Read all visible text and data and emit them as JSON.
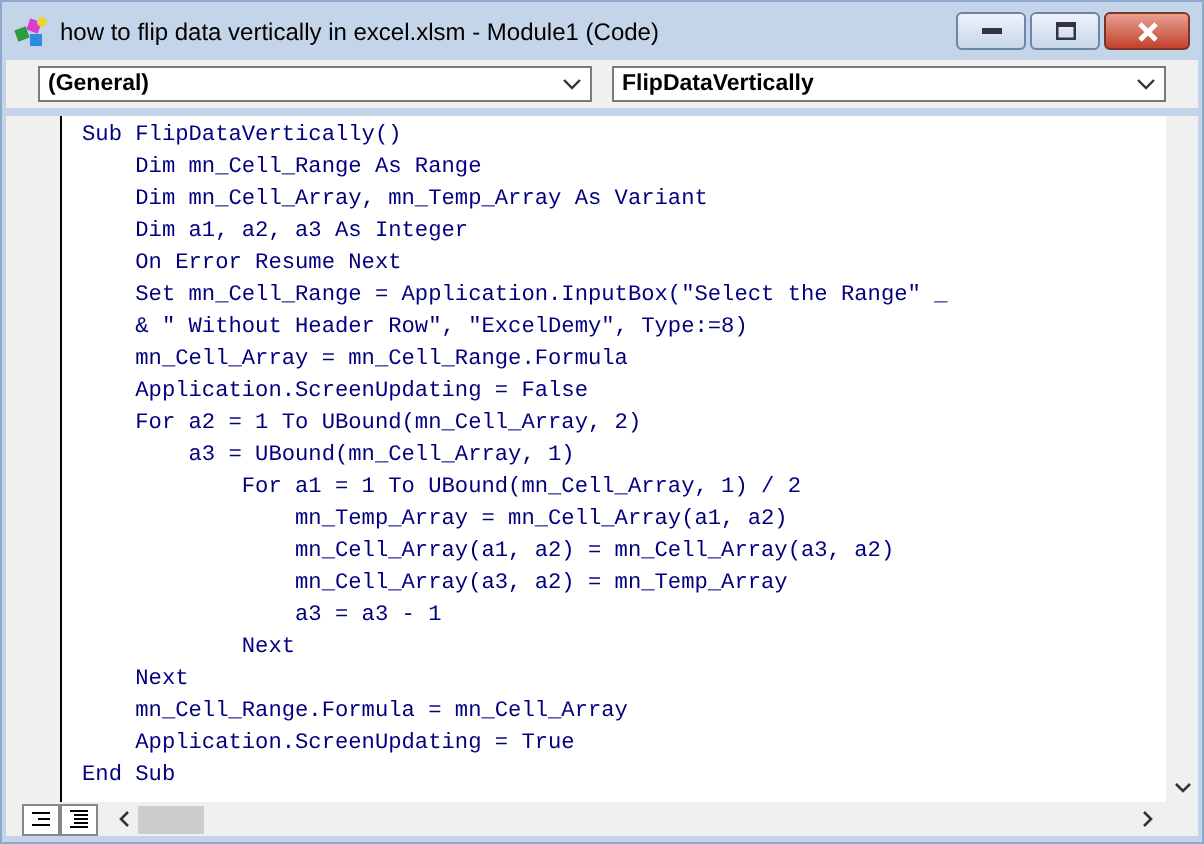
{
  "window": {
    "title": "how to flip data vertically in excel.xlsm - Module1 (Code)"
  },
  "object_box": {
    "value": "(General)"
  },
  "procedure_box": {
    "value": "FlipDataVertically"
  },
  "code_lines": [
    "Sub FlipDataVertically()",
    "    Dim mn_Cell_Range As Range",
    "    Dim mn_Cell_Array, mn_Temp_Array As Variant",
    "    Dim a1, a2, a3 As Integer",
    "    On Error Resume Next",
    "    Set mn_Cell_Range = Application.InputBox(\"Select the Range\" _",
    "    & \" Without Header Row\", \"ExcelDemy\", Type:=8)",
    "    mn_Cell_Array = mn_Cell_Range.Formula",
    "    Application.ScreenUpdating = False",
    "    For a2 = 1 To UBound(mn_Cell_Array, 2)",
    "        a3 = UBound(mn_Cell_Array, 1)",
    "            For a1 = 1 To UBound(mn_Cell_Array, 1) / 2",
    "                mn_Temp_Array = mn_Cell_Array(a1, a2)",
    "                mn_Cell_Array(a1, a2) = mn_Cell_Array(a3, a2)",
    "                mn_Cell_Array(a3, a2) = mn_Temp_Array",
    "                a3 = a3 - 1",
    "            Next",
    "    Next",
    "    mn_Cell_Range.Formula = mn_Cell_Array",
    "    Application.ScreenUpdating = True",
    "End Sub"
  ]
}
